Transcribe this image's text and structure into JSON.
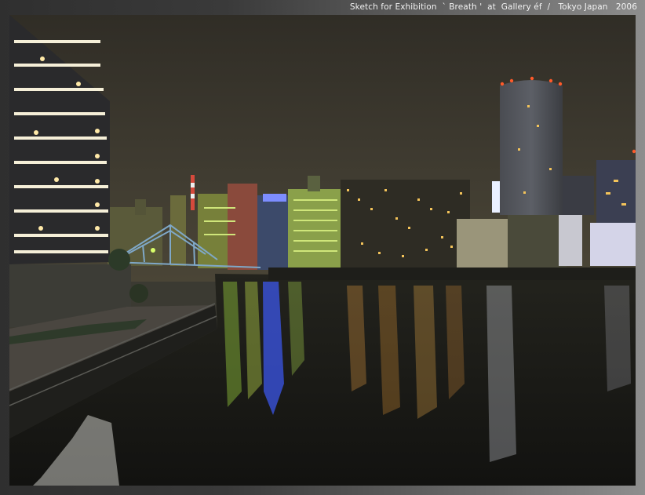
{
  "caption": "Sketch for Exhibition  ` Breath '  at  Gallery éf  /   Tokyo Japan   2006",
  "photo": {
    "subject": "night-river-city-skyline",
    "colors": {
      "sky": "#3e3b31",
      "water": "#1a1a16",
      "light_warm": "#f4c25a",
      "light_green": "#a8d24a",
      "light_blue": "#3f5cff"
    }
  }
}
